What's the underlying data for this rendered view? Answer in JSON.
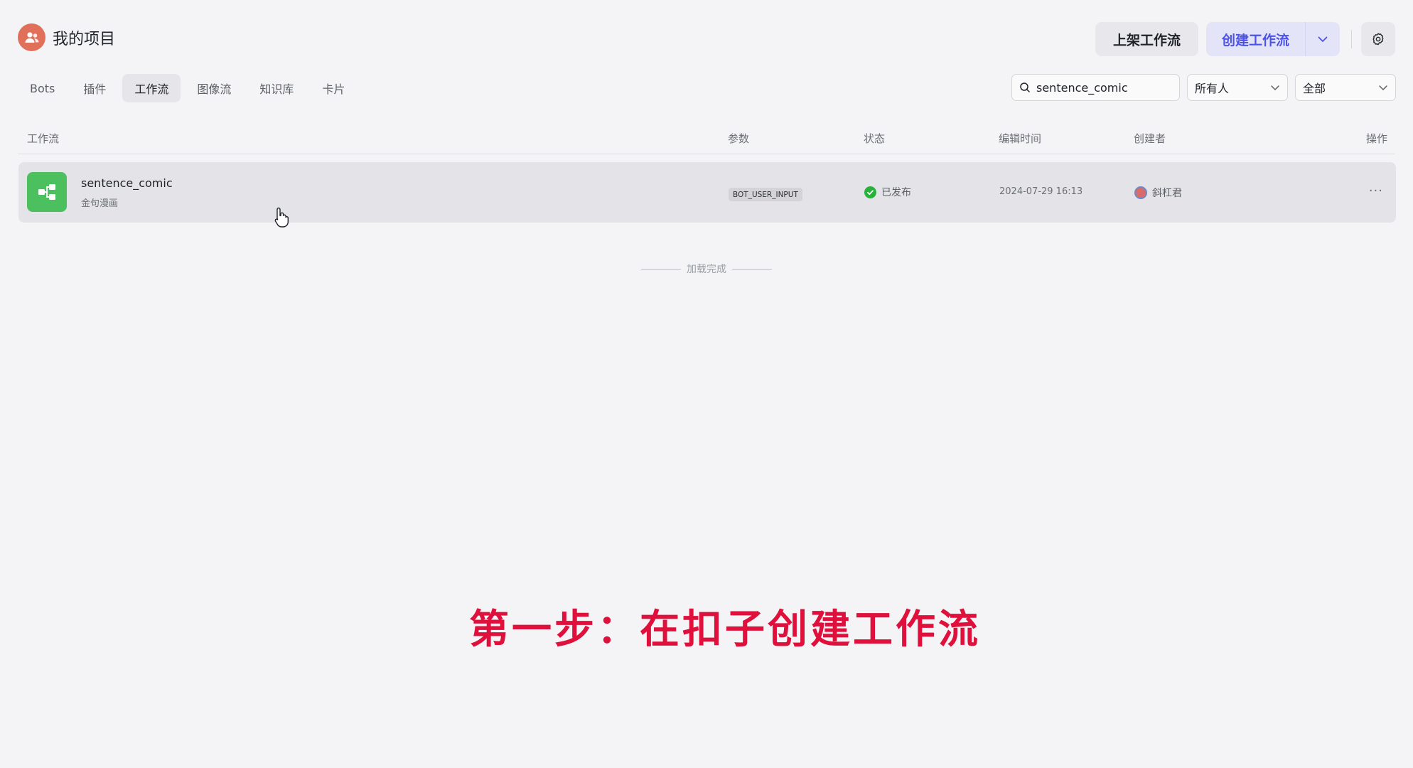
{
  "header": {
    "title": "我的项目",
    "publish_button": "上架工作流",
    "create_button": "创建工作流"
  },
  "tabs": [
    {
      "label": "Bots",
      "active": false
    },
    {
      "label": "插件",
      "active": false
    },
    {
      "label": "工作流",
      "active": true
    },
    {
      "label": "图像流",
      "active": false
    },
    {
      "label": "知识库",
      "active": false
    },
    {
      "label": "卡片",
      "active": false
    }
  ],
  "filters": {
    "search_value": "sentence_comic",
    "owner_select": "所有人",
    "status_select": "全部"
  },
  "table": {
    "columns": {
      "workflow": "工作流",
      "params": "参数",
      "status": "状态",
      "edit_time": "编辑时间",
      "creator": "创建者",
      "actions": "操作"
    },
    "rows": [
      {
        "name": "sentence_comic",
        "description": "金句漫画",
        "param": "BOT_USER_INPUT",
        "status": "已发布",
        "edit_time": "2024-07-29 16:13",
        "creator": "斜杠君",
        "more": "···"
      }
    ]
  },
  "loaded_text": "加载完成",
  "caption": "第一步：在扣子创建工作流",
  "colors": {
    "accent": "#4d53e8",
    "status_published": "#25b33a",
    "caption": "#e0103c",
    "workflow_icon": "#4cc05e"
  }
}
